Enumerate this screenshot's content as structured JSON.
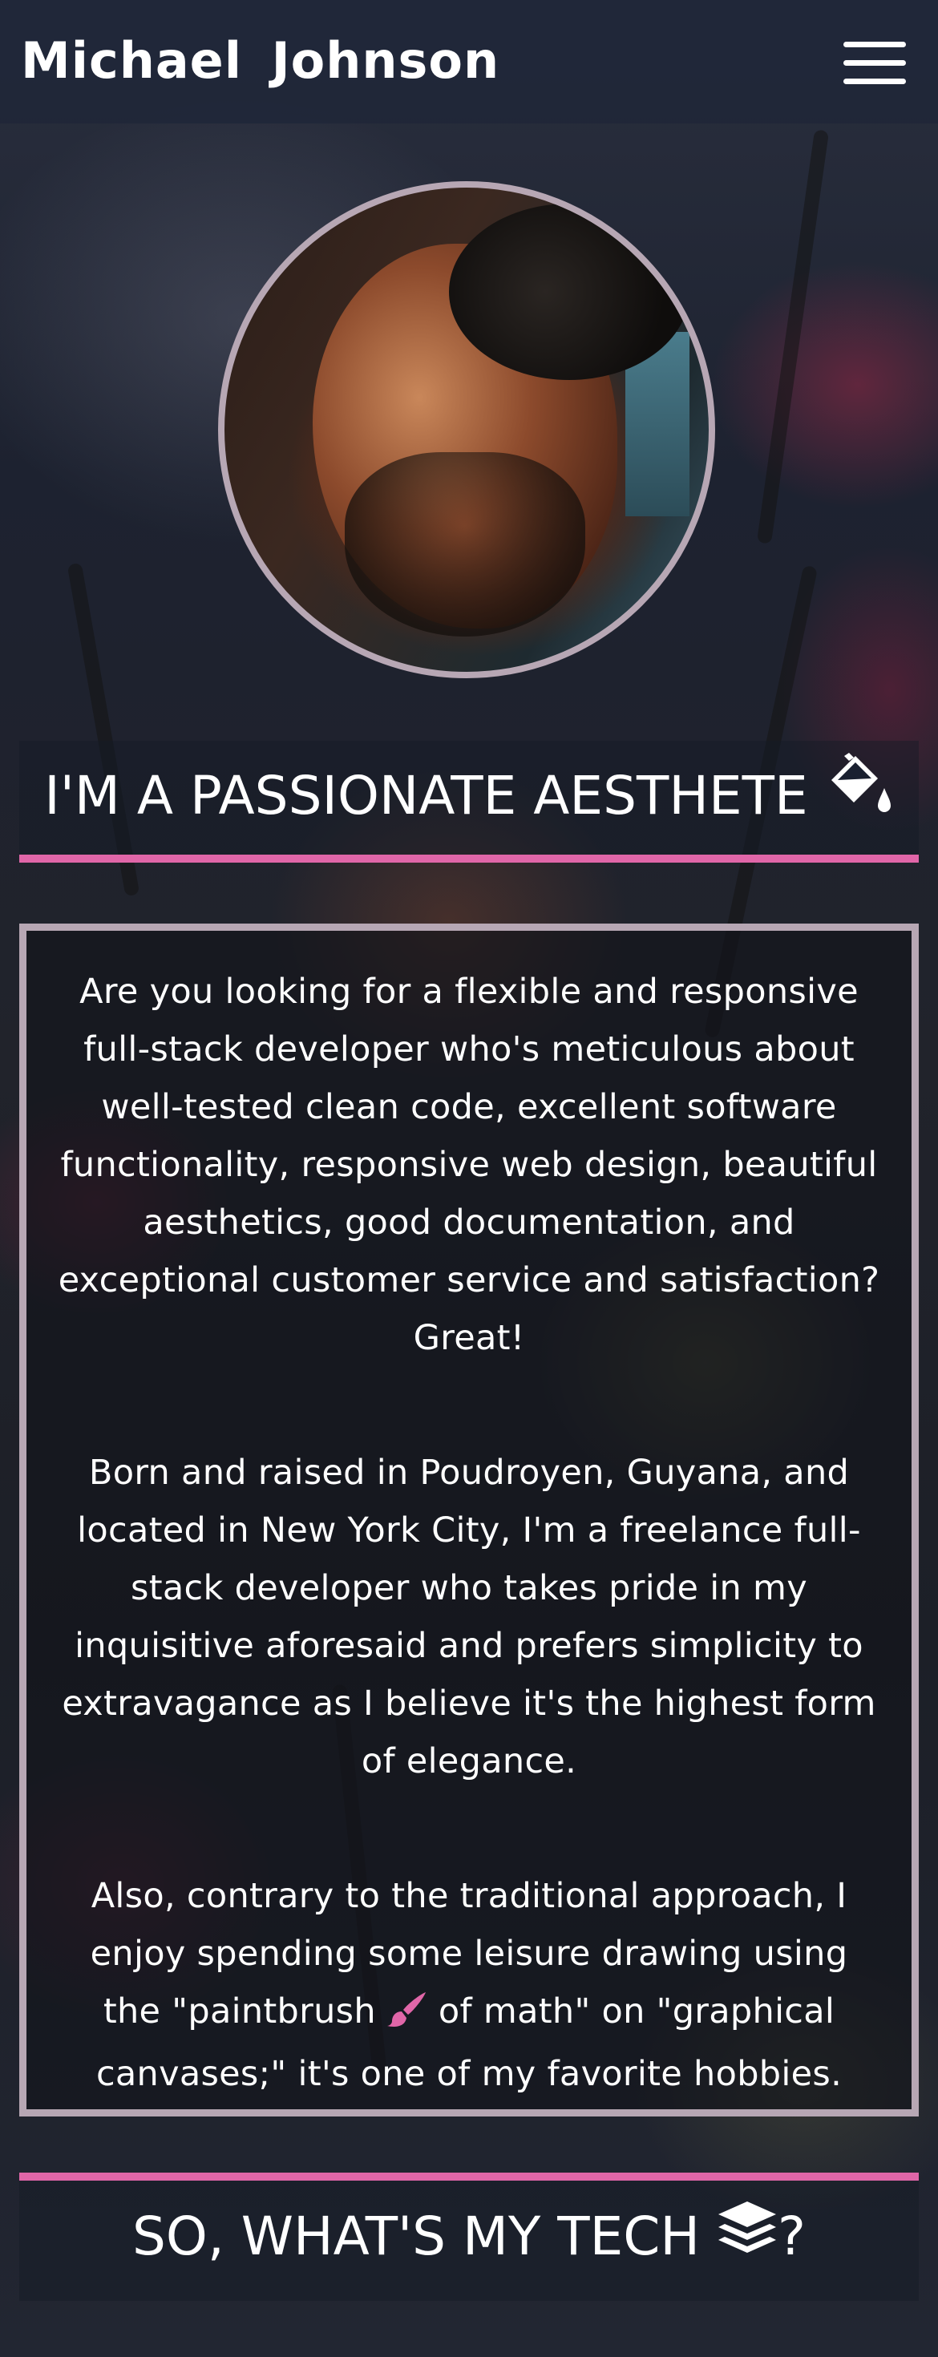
{
  "header": {
    "brand": "Michael Johnson",
    "menu_icon": "hamburger-menu-icon"
  },
  "profile": {
    "avatar_icon": "profile-photo"
  },
  "about": {
    "heading": "I'M A PASSIONATE AESTHETE",
    "heading_icon": "paint-bucket-icon",
    "paragraphs": [
      "Are you looking for a flexible and responsive full-stack developer who's meticulous about well-tested clean code, excellent software functionality, responsive web design, beautiful aesthetics, good documentation, and exceptional customer service and satisfaction? Great!",
      "Born and raised in Poudroyen, Guyana, and located in New York City, I'm a freelance full-stack developer who takes pride in my inquisitive aforesaid and prefers simplicity to extravagance as I believe it's the highest form of elegance."
    ],
    "paragraph3_before": "Also, contrary to the traditional approach, I enjoy spending some leisure drawing using the \"paintbrush ",
    "paragraph3_icon": "paintbrush-icon",
    "paragraph3_after": " of math\" on \"graphical canvases;\" it's one of my favorite hobbies."
  },
  "tech": {
    "heading_before": "SO, WHAT'S MY TECH ",
    "heading_icon": "layer-stack-icon",
    "heading_after": "?"
  },
  "colors": {
    "accent": "#e066a8",
    "frame": "#b7a7b4",
    "header_bg": "#1e2638"
  }
}
